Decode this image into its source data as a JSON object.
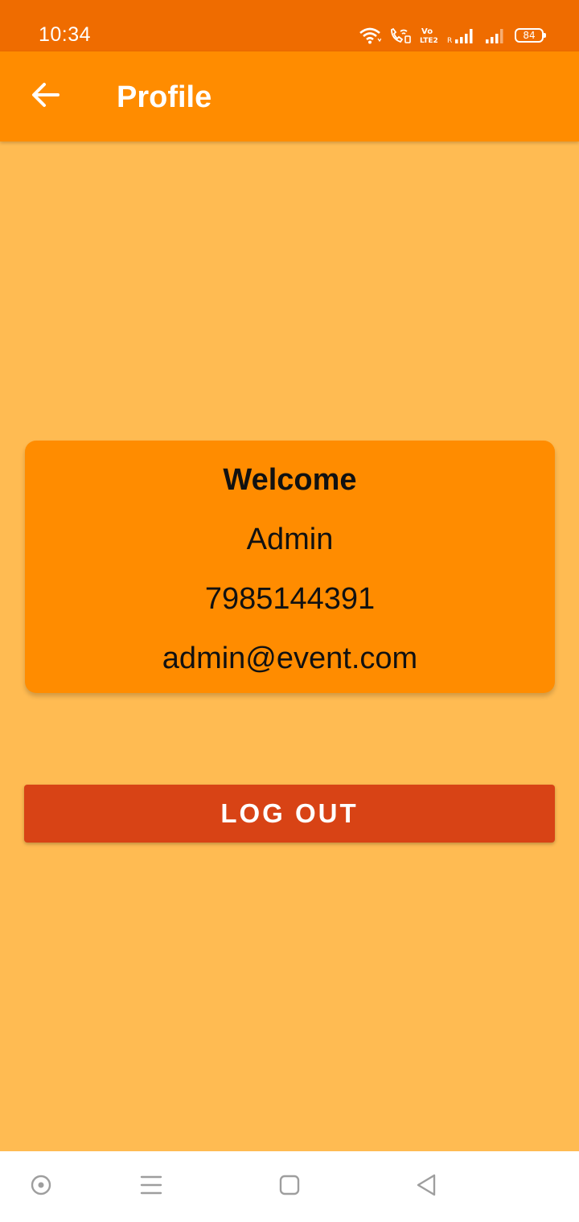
{
  "status_bar": {
    "time": "10:34",
    "battery": "84",
    "icons": [
      "wifi-icon",
      "wifi-calling-icon",
      "volte-icon",
      "signal-icon",
      "signal-icon-2",
      "battery-icon"
    ]
  },
  "app_bar": {
    "title": "Profile",
    "back_icon": "arrow-left-icon"
  },
  "profile_card": {
    "heading": "Welcome",
    "name": "Admin",
    "phone": "7985144391",
    "email": "admin@event.com"
  },
  "actions": {
    "logout_label": "LOG OUT"
  },
  "nav_bar": {
    "icons": [
      "assistant-icon",
      "recents-icon",
      "home-icon",
      "back-icon"
    ]
  },
  "colors": {
    "status_bar": "#ef6c00",
    "app_bar": "#ff8c00",
    "background": "#ffbb52",
    "card": "#ff8c00",
    "logout_button": "#d84315"
  }
}
